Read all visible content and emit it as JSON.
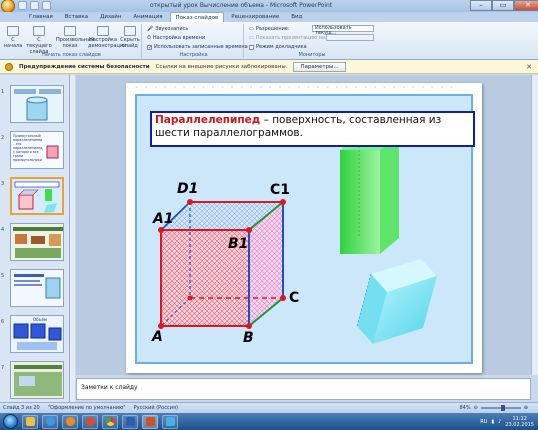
{
  "window": {
    "title": "открытый урок Вычисление объема - Microsoft PowerPoint",
    "minimize": "–",
    "maximize": "▭",
    "close": "✕"
  },
  "tabs": [
    "Главная",
    "Вставка",
    "Дизайн",
    "Анимация",
    "Показ слайдов",
    "Рецензирование",
    "Вид"
  ],
  "active_tab": "Показ слайдов",
  "ribbon": {
    "start_group": {
      "caption": "Начать показ слайдов",
      "buttons": [
        "С начала",
        "С текущего слайда",
        "Произвольный показ",
        "Настройка демонстрации",
        "Скрыть слайд"
      ]
    },
    "setup_group": {
      "caption": "Настройка",
      "items": [
        "Звукозапись",
        "Настройка времени",
        "Использовать записанные времена"
      ]
    },
    "monitors_group": {
      "caption": "Мониторы",
      "resolution_label": "Разрешение:",
      "resolution_value": "Использовать текущ...",
      "show_on_label": "Показать презентацию на:",
      "presenter_view": "Режим докладчика"
    }
  },
  "security_bar": {
    "title": "Предупреждение системы безопасности",
    "message": "Ссылки на внешние рисунки заблокированы.",
    "button": "Параметры...",
    "close": "✕"
  },
  "thumbnails": {
    "numbers": [
      "1",
      "2",
      "3",
      "4",
      "5",
      "6",
      "7"
    ],
    "selected": 3,
    "slide2_text": "Прямоугольный параллелепипед – это параллелепипед, у которого все грани прямоугольники",
    "slide6_label": "Объём"
  },
  "slide": {
    "term": "Параллелепипед",
    "definition": " – поверхность, составленная из шести параллелограммов.",
    "vertices": {
      "D1": "D1",
      "C1": "C1",
      "A1": "A1",
      "B1": "B1",
      "C": "C",
      "A": "A",
      "B": "B"
    },
    "colors": {
      "edge_red": "#e0161f",
      "edge_blue": "#1a53c8",
      "edge_green": "#1a9a2b",
      "green_prism": "#3ee04a",
      "cyan_prism": "#5fe0f0"
    }
  },
  "notes": {
    "placeholder": "Заметки к слайду"
  },
  "statusbar": {
    "slide_counter": "Слайд 3 из 20",
    "theme": "\"Оформление по умолчанию\"",
    "language": "Русский (Россия)",
    "zoom": "84%"
  },
  "taskbar": {
    "lang": "RU",
    "time": "11:12",
    "date": "23.02.2015"
  }
}
